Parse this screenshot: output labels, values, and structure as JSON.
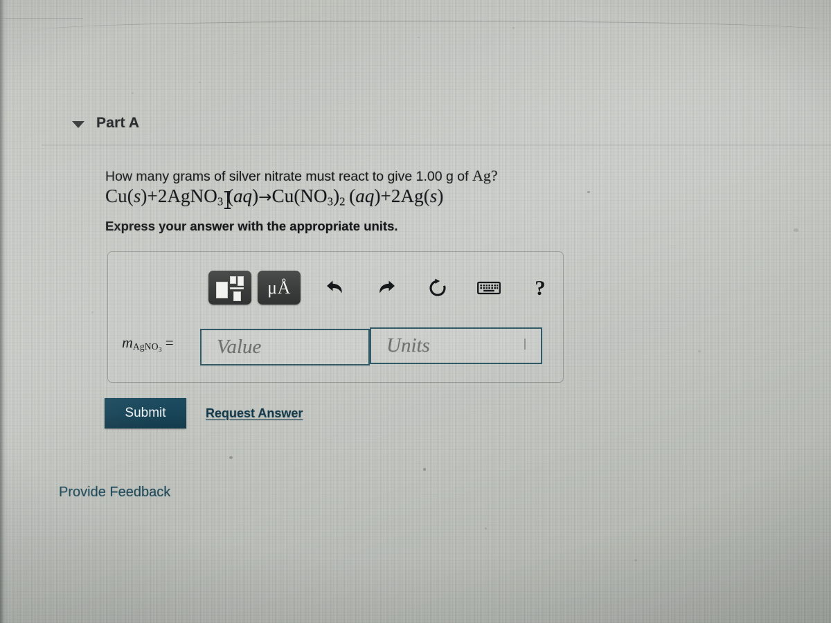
{
  "part": {
    "title": "Part A",
    "caret_icon": "caret-down-icon"
  },
  "question": {
    "prompt_before": "How many grams of silver nitrate must react to give 1.00 g of ",
    "prompt_symbol": "Ag",
    "prompt_after": "?",
    "equation_plain": "Cu(s)+2AgNO3(aq)→Cu(NO3)2(aq)+2Ag(s)",
    "equation_parts": {
      "reactant_1": "Cu",
      "reactant_1_state": "s",
      "plus": "+",
      "coeff_2": "2",
      "reactant_2": "AgNO",
      "reactant_2_sub": "3",
      "reactant_2_state": "aq",
      "arrow": "→",
      "product_1_a": "Cu(NO",
      "product_1_sub_a": "3",
      "product_1_b": ")",
      "product_1_sub_b": "2",
      "product_1_state": "aq",
      "product_2_coeff": "2",
      "product_2": "Ag",
      "product_2_state": "s"
    },
    "instruction": "Express your answer with the appropriate units."
  },
  "toolbar": {
    "template_button": "template-button",
    "units_button_label": "μÅ",
    "undo_label": "undo",
    "redo_label": "redo",
    "reset_label": "reset",
    "keyboard_label": "keyboard",
    "help_label": "?"
  },
  "answer": {
    "variable_m": "m",
    "variable_sub_a": "AgNO",
    "variable_sub_b": "3",
    "equals": "=",
    "value_placeholder": "Value",
    "value_text": "",
    "units_placeholder": "Units",
    "units_text": ""
  },
  "actions": {
    "submit_label": "Submit",
    "request_answer_label": "Request Answer",
    "provide_feedback_label": "Provide Feedback"
  },
  "colors": {
    "submit_bg": "#184457",
    "link": "#13394b",
    "feedback": "#1d4858",
    "field_border": "#2f5a66",
    "toolbar_button_bg": "#3b3d3c",
    "page_bg": "#c7cac5"
  }
}
